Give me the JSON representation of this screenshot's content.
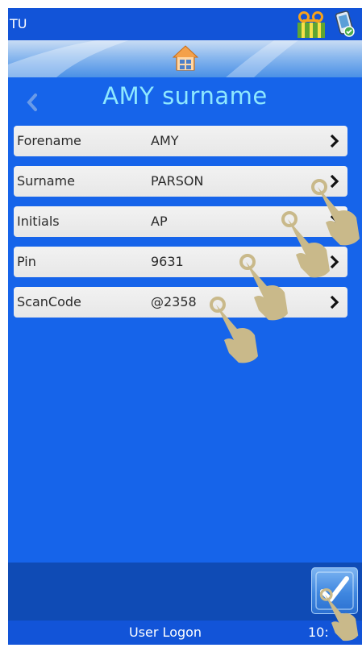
{
  "status_bar": {
    "title": "TU"
  },
  "page": {
    "title": "AMY surname"
  },
  "fields": [
    {
      "label": "Forename",
      "value": "AMY"
    },
    {
      "label": "Surname",
      "value": "PARSON"
    },
    {
      "label": "Initials",
      "value": "AP"
    },
    {
      "label": "Pin",
      "value": "9631"
    },
    {
      "label": "ScanCode",
      "value": "@2358"
    }
  ],
  "bottom_bar": {
    "label": "User Logon",
    "clock": "10:"
  },
  "icons": {
    "printer": "printer-status-icon",
    "device": "device-status-icon",
    "home": "home-icon",
    "back": "back-chevron-icon",
    "row_chevron": "chevron-right-icon",
    "confirm": "checkmark-icon",
    "touch": "touch-hand-icon"
  },
  "colors": {
    "background": "#1664ea",
    "title": "#8ee8ff",
    "row": "#efefef",
    "bottom_bar": "#1254d8"
  }
}
